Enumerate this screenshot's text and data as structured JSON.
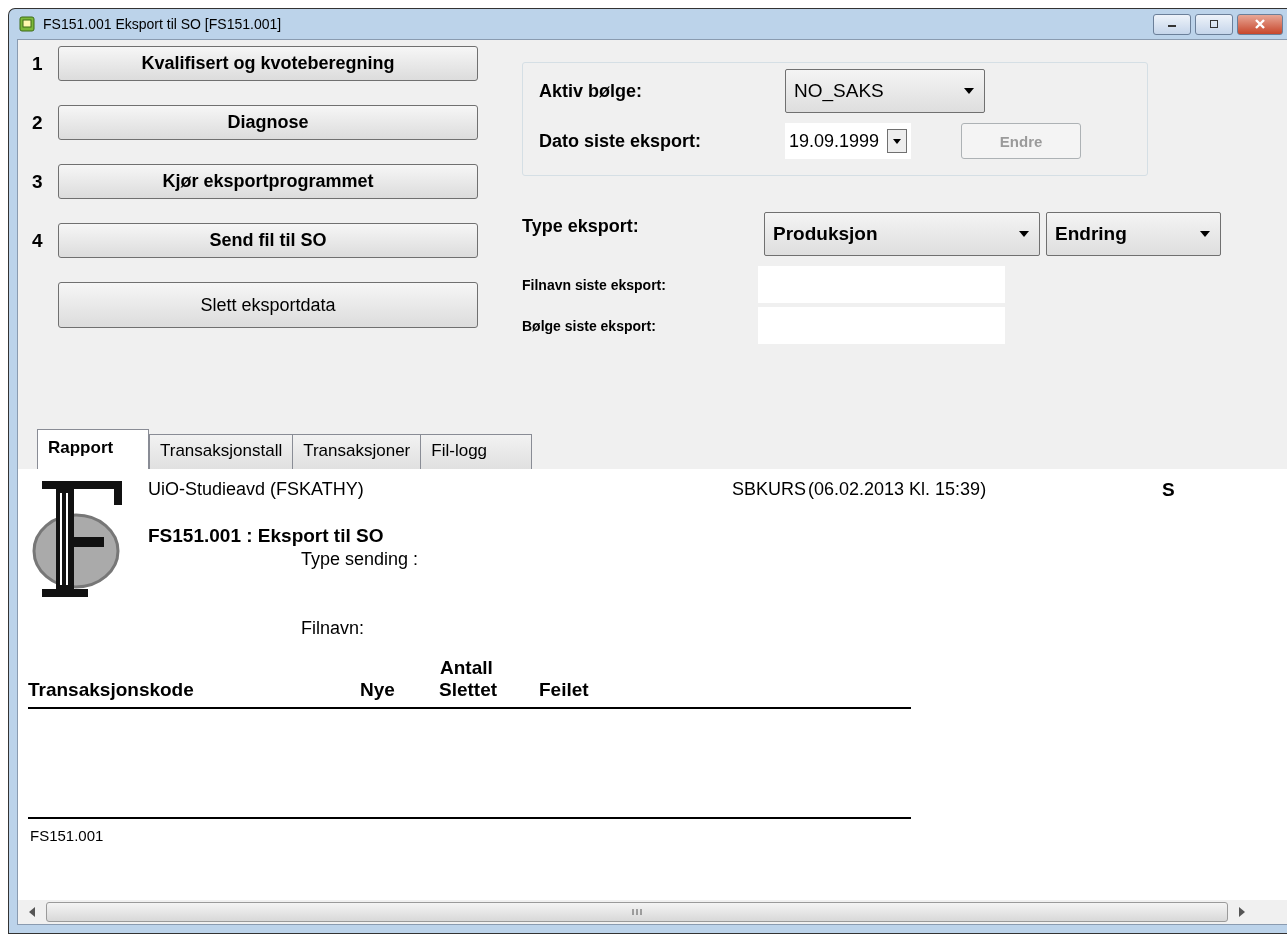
{
  "window": {
    "title": "FS151.001 Eksport til SO [FS151.001]"
  },
  "steps": [
    {
      "number": "1",
      "label": "Kvalifisert og kvoteberegning",
      "kind": "step"
    },
    {
      "number": "2",
      "label": "Diagnose",
      "kind": "step"
    },
    {
      "number": "3",
      "label": "Kjør eksportprogrammet",
      "kind": "step"
    },
    {
      "number": "4",
      "label": "Send fil til SO",
      "kind": "step"
    },
    {
      "label": "Slett eksportdata",
      "kind": "plain"
    }
  ],
  "wave_group": {
    "active_wave_label": "Aktiv bølge:",
    "active_wave_value": "NO_SAKS",
    "date_label": "Dato siste eksport:",
    "date_value": "19.09.1999",
    "change_button": {
      "label": "Endre",
      "disabled": true
    }
  },
  "export_type": {
    "label": "Type eksport:",
    "mode": "Produksjon",
    "change": "Endring"
  },
  "last_file_label": "Filnavn siste eksport:",
  "last_wave_label": "Bølge siste eksport:",
  "tabs": [
    {
      "label": "Rapport",
      "selected": true
    },
    {
      "label": "Transaksjonstall",
      "selected": false
    },
    {
      "label": "Transaksjoner",
      "selected": false
    },
    {
      "label": "Fil-logg",
      "selected": false
    }
  ],
  "report": {
    "org": "UiO-Studieavd (FSKATHY)",
    "db": "SBKURS",
    "timestamp": "(06.02.2013 Kl. 15:39)",
    "column_3": "S",
    "title": "FS151.001 : Eksport til SO",
    "type_label": "Type sending :",
    "file_label": "Filnavn:",
    "group_header": "Antall",
    "columns": [
      "Transaksjonskode",
      "Nye",
      "Slettet",
      "Feilet"
    ],
    "footer": "FS151.001"
  }
}
